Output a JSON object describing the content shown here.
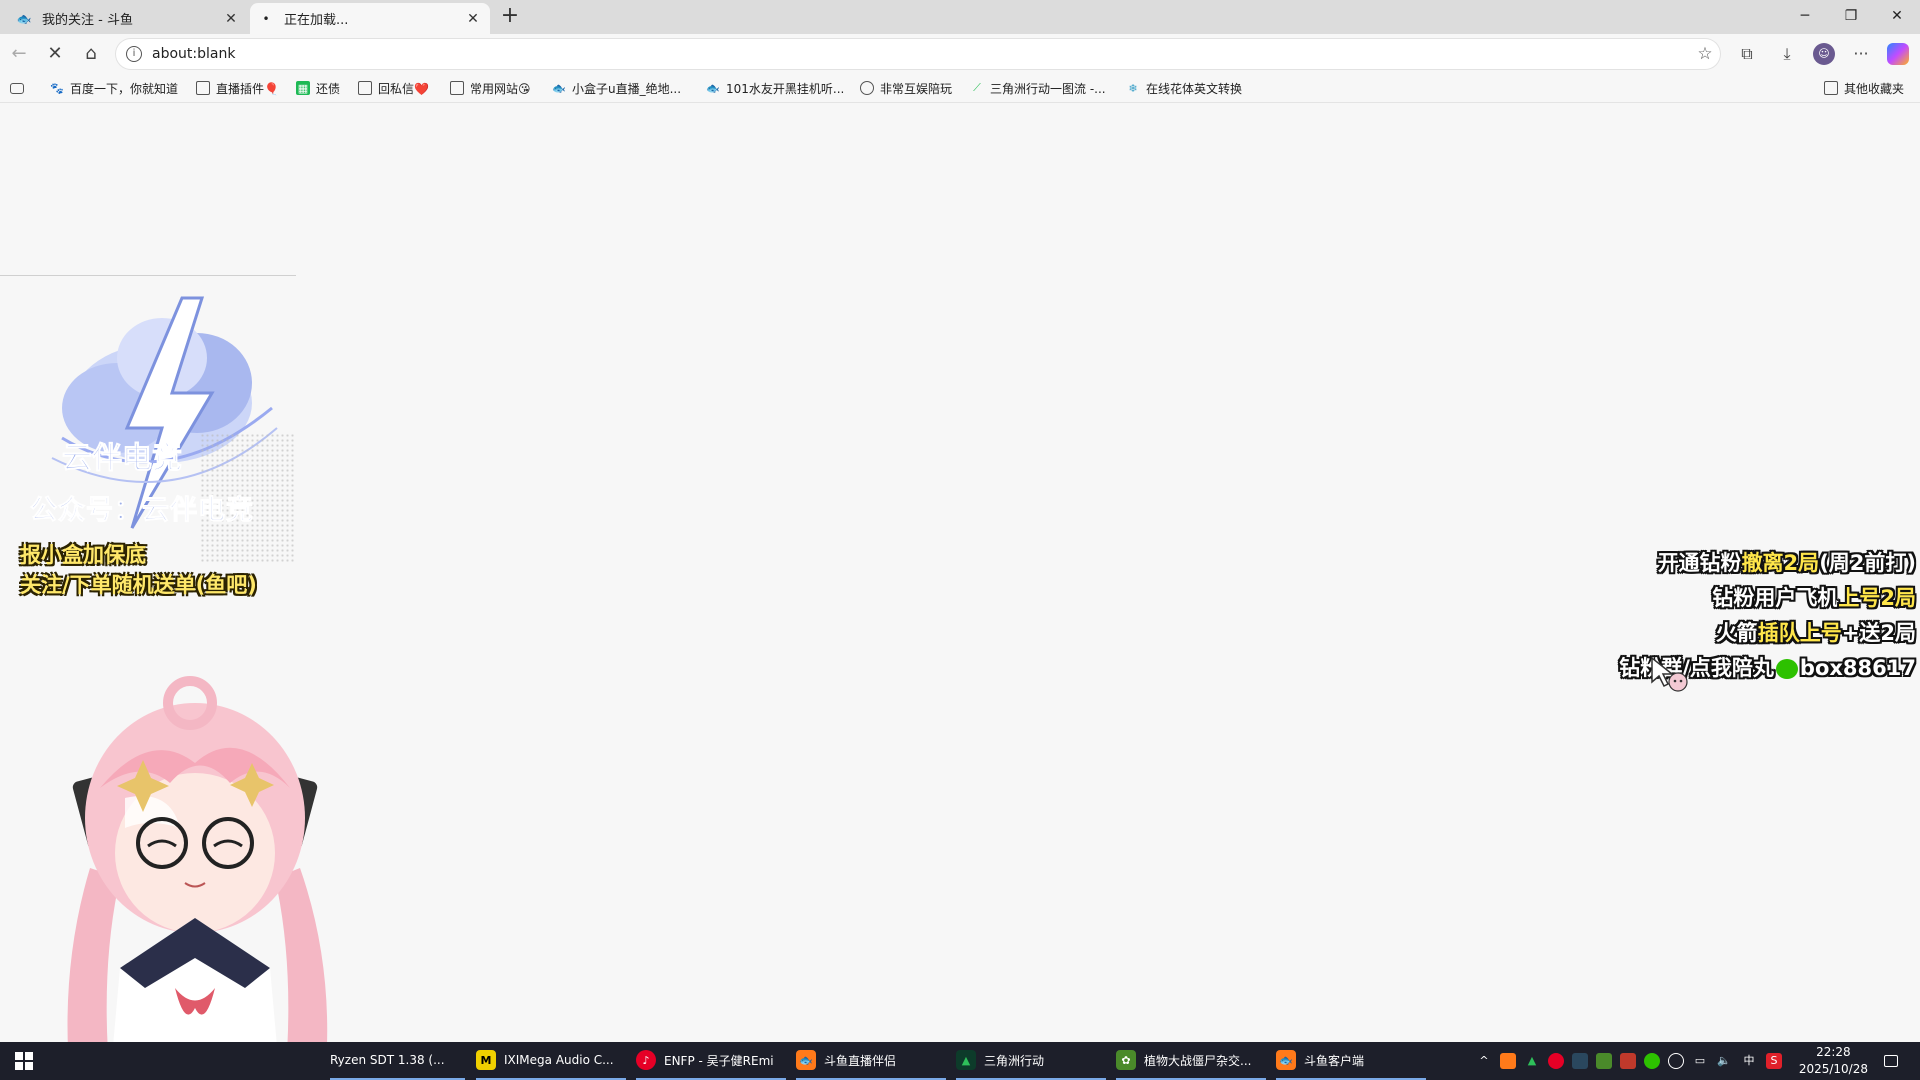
{
  "browser": {
    "tabs": [
      {
        "title": "我的关注 - 斗鱼",
        "active": false
      },
      {
        "title": "正在加载...",
        "active": true
      }
    ],
    "address": "about:blank",
    "bookmarks": [
      "百度一下，你就知道",
      "直播插件🎈",
      "还债",
      "回私信❤️",
      "常用网站😘",
      "小盒子u直播_绝地...",
      "101水友开黑挂机听...",
      "非常互娱陪玩",
      "三角洲行动一图流 -...",
      "在线花体英文转换"
    ],
    "other_bookmarks": "其他收藏夹"
  },
  "overlay": {
    "logo_text": "云伴电竞",
    "logo_sub": "公众号：云伴电竞",
    "left_lines": [
      "报小盒加保底",
      "关注/下单随机送单(鱼吧)"
    ],
    "right_lines": [
      {
        "parts": [
          {
            "t": "开通钻粉",
            "hl": false
          },
          {
            "t": "撤离2局",
            "hl": true
          },
          {
            "t": "(周2前打)",
            "hl": false
          }
        ]
      },
      {
        "parts": [
          {
            "t": "钻粉用户飞机",
            "hl": false
          },
          {
            "t": "上号2局",
            "hl": true
          }
        ]
      },
      {
        "parts": [
          {
            "t": "火箭",
            "hl": false
          },
          {
            "t": "插队上号",
            "hl": true
          },
          {
            "t": "+送2局",
            "hl": false
          }
        ]
      },
      {
        "parts": [
          {
            "t": "钻粉群/点我陪丸",
            "hl": false
          },
          {
            "t": "box88617",
            "hl": false
          }
        ]
      }
    ]
  },
  "taskbar": {
    "items": [
      "Ryzen SDT 1.38 (...",
      "IXIMega Audio C...",
      "ENFP - 吴子健REmi",
      "斗鱼直播伴侣",
      "三角洲行动",
      "植物大战僵尸杂交...",
      "斗鱼客户端"
    ],
    "ime": "中",
    "time": "22:28",
    "date": "2025/10/28"
  },
  "colors": {
    "highlight": "#ffe64a",
    "taskbar_bg": "#1d1f2a",
    "accent": "#7aa9e6"
  }
}
